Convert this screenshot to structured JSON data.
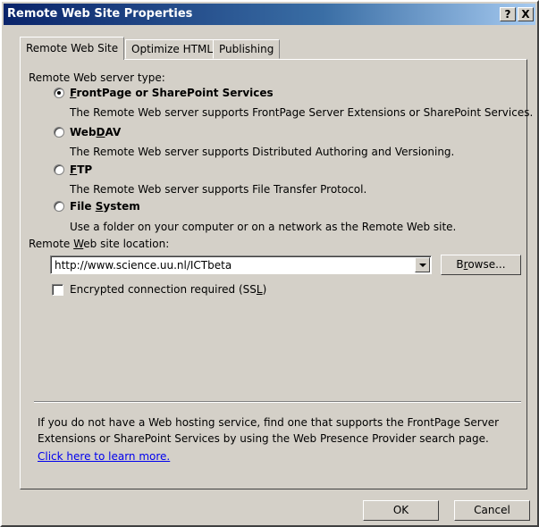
{
  "window": {
    "title": "Remote Web Site Properties",
    "help_label": "?",
    "close_label": "X"
  },
  "tabs": [
    {
      "label": "Remote Web Site"
    },
    {
      "label": "Optimize HTML"
    },
    {
      "label": "Publishing"
    }
  ],
  "server_type": {
    "label": "Remote Web server type:",
    "options": [
      {
        "key": "F",
        "rest": "rontPage or SharePoint Services",
        "description": "The Remote Web server supports FrontPage Server Extensions or SharePoint Services.",
        "selected": true
      },
      {
        "pre": "Web",
        "key": "D",
        "rest": "AV",
        "description": "The Remote Web server supports Distributed Authoring and Versioning.",
        "selected": false
      },
      {
        "key": "F",
        "rest": "TP",
        "description": "The Remote Web server supports File Transfer Protocol.",
        "selected": false
      },
      {
        "pre": "File ",
        "key": "S",
        "rest": "ystem",
        "description": "Use a folder on your computer or on a network as the Remote Web site.",
        "selected": false
      }
    ]
  },
  "location": {
    "label_pre": "Remote ",
    "label_key": "W",
    "label_rest": "eb site location:",
    "value": "http://www.science.uu.nl/ICTbeta",
    "browse_key": "r",
    "browse_pre": "B",
    "browse_rest": "owse..."
  },
  "ssl": {
    "label_pre": "Encrypted connection required (SS",
    "label_key": "L",
    "label_rest": ")",
    "checked": false
  },
  "info": {
    "line1": "If you do not have a Web hosting service, find one that supports the FrontPage Server",
    "line2": "Extensions or SharePoint Services by using the Web Presence Provider search page.",
    "link": "Click here to learn more."
  },
  "buttons": {
    "ok": "OK",
    "cancel": "Cancel"
  }
}
